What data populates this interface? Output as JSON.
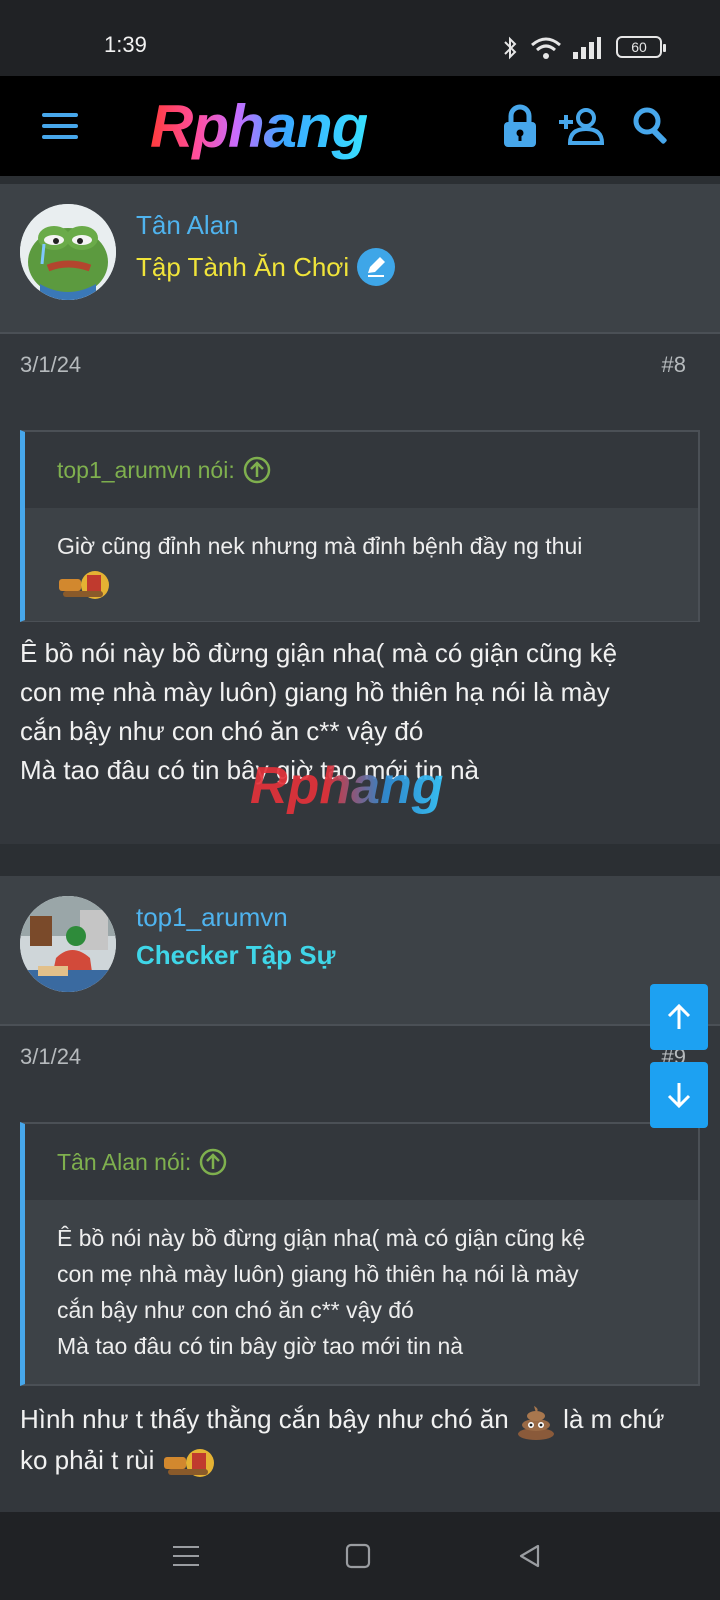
{
  "status": {
    "time": "1:39",
    "battery": "60"
  },
  "header": {
    "logo": "Rphang",
    "icons": [
      "menu-icon",
      "lock-icon",
      "add-user-icon",
      "search-icon"
    ]
  },
  "watermark": "Rphang",
  "posts": [
    {
      "username": "Tân Alan",
      "user_title": "Tập Tành Ăn Chơi",
      "user_title_color": "#f0e43a",
      "date": "3/1/24",
      "number": "#8",
      "quote": {
        "author": "top1_arumvn nói:",
        "text": "Giờ cũng đỉnh nek nhưng mà đỉnh bệnh đầy ng thui"
      },
      "body_lines": [
        "Ê bồ nói này bồ đừng giận nha( mà có giận cũng kệ",
        "con mẹ nhà mày luôn) giang hồ thiên hạ nói là mày",
        "cắn bậy như con chó ăn c** vậy đó",
        "Mà tao đâu có tin bây giờ tao mới tin nà"
      ]
    },
    {
      "username": "top1_arumvn",
      "user_title": "Checker Tập Sự",
      "user_title_color": "#3fd6e8",
      "date": "3/1/24",
      "number": "#9",
      "quote": {
        "author": "Tân Alan nói:",
        "lines": [
          "Ê bồ nói này bồ đừng giận nha( mà có giận cũng kệ",
          "con mẹ nhà mày luôn) giang hồ thiên hạ nói là mày",
          "cắn bậy như con chó ăn c** vậy đó",
          "Mà tao đâu có tin bây giờ tao mới tin nà"
        ]
      },
      "body_line1_a": "Hình như t thấy thằng cắn bậy như chó ăn",
      "body_line1_b": "là m chứ",
      "body_line2": "ko phải t rùi"
    }
  ],
  "colors": {
    "accent": "#1da1f2",
    "username": "#4fb3ee",
    "quote_author": "#7fb04e"
  }
}
